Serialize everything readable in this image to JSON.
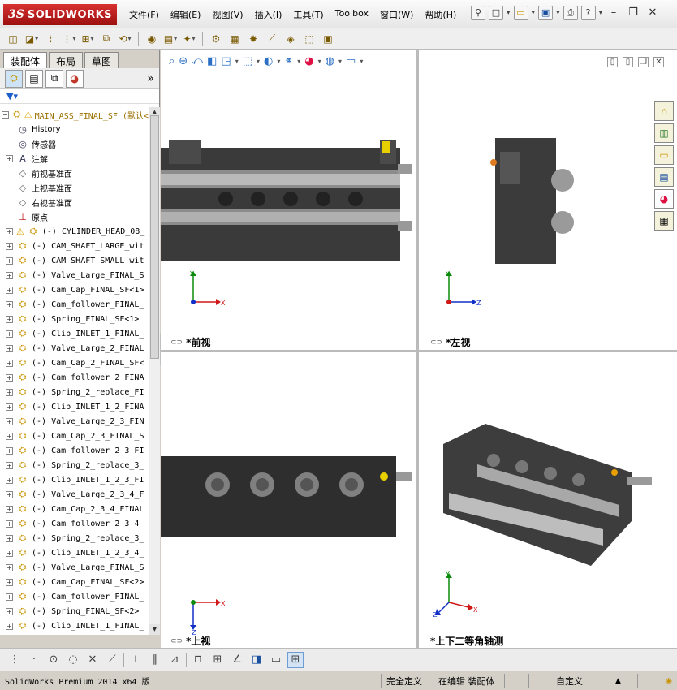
{
  "app": {
    "logo_ds": "3S",
    "logo_text": "SOLIDWORKS"
  },
  "menu": [
    "文件(F)",
    "编辑(E)",
    "视图(V)",
    "插入(I)",
    "工具(T)",
    "Toolbox",
    "窗口(W)",
    "帮助(H)"
  ],
  "feature_manager": {
    "tabs": [
      "装配体",
      "布局",
      "草图"
    ],
    "expand_arrow": "»",
    "tree": [
      {
        "label": "MAIN_ASS_FINAL_SF  (默认<",
        "icon": "assembly-icon",
        "warn": true,
        "root": true,
        "exp": "-"
      },
      {
        "label": "History",
        "icon": "history-icon",
        "exp": ""
      },
      {
        "label": "传感器",
        "icon": "sensor-icon",
        "exp": ""
      },
      {
        "label": "注解",
        "icon": "annotation-icon",
        "exp": "+"
      },
      {
        "label": "前视基准面",
        "icon": "plane-icon",
        "exp": ""
      },
      {
        "label": "上视基准面",
        "icon": "plane-icon",
        "exp": ""
      },
      {
        "label": "右视基准面",
        "icon": "plane-icon",
        "exp": ""
      },
      {
        "label": "原点",
        "icon": "origin-icon",
        "exp": ""
      },
      {
        "label": "(-) CYLINDER_HEAD_08_",
        "icon": "part-icon",
        "warn": true,
        "exp": "+"
      },
      {
        "label": "(-) CAM_SHAFT_LARGE_wit",
        "icon": "part-icon",
        "exp": "+"
      },
      {
        "label": "(-) CAM_SHAFT_SMALL_wit",
        "icon": "part-icon",
        "exp": "+"
      },
      {
        "label": "(-) Valve_Large_FINAL_S",
        "icon": "part-icon",
        "exp": "+"
      },
      {
        "label": "(-) Cam_Cap_FINAL_SF<1>",
        "icon": "part-icon",
        "exp": "+"
      },
      {
        "label": "(-) Cam_follower_FINAL_",
        "icon": "part-icon",
        "exp": "+"
      },
      {
        "label": "(-) Spring_FINAL_SF<1>",
        "icon": "part-icon",
        "exp": "+"
      },
      {
        "label": "(-) Clip_INLET_1_FINAL_",
        "icon": "part-icon",
        "exp": "+"
      },
      {
        "label": "(-) Valve_Large_2_FINAL",
        "icon": "part-icon",
        "exp": "+"
      },
      {
        "label": "(-) Cam_Cap_2_FINAL_SF<",
        "icon": "part-icon",
        "exp": "+"
      },
      {
        "label": "(-) Cam_follower_2_FINA",
        "icon": "part-icon",
        "exp": "+"
      },
      {
        "label": "(-) Spring_2_replace_FI",
        "icon": "part-icon",
        "exp": "+"
      },
      {
        "label": "(-) Clip_INLET_1_2_FINA",
        "icon": "part-icon",
        "exp": "+"
      },
      {
        "label": "(-) Valve_Large_2_3_FIN",
        "icon": "part-icon",
        "exp": "+"
      },
      {
        "label": "(-) Cam_Cap_2_3_FINAL_S",
        "icon": "part-icon",
        "exp": "+"
      },
      {
        "label": "(-) Cam_follower_2_3_FI",
        "icon": "part-icon",
        "exp": "+"
      },
      {
        "label": "(-) Spring_2_replace_3_",
        "icon": "part-icon",
        "exp": "+"
      },
      {
        "label": "(-) Clip_INLET_1_2_3_FI",
        "icon": "part-icon",
        "exp": "+"
      },
      {
        "label": "(-) Valve_Large_2_3_4_F",
        "icon": "part-icon",
        "exp": "+"
      },
      {
        "label": "(-) Cam_Cap_2_3_4_FINAL",
        "icon": "part-icon",
        "exp": "+"
      },
      {
        "label": "(-) Cam_follower_2_3_4_",
        "icon": "part-icon",
        "exp": "+"
      },
      {
        "label": "(-) Spring_2_replace_3_",
        "icon": "part-icon",
        "exp": "+"
      },
      {
        "label": "(-) Clip_INLET_1_2_3_4_",
        "icon": "part-icon",
        "exp": "+"
      },
      {
        "label": "(-) Valve_Large_FINAL_S",
        "icon": "part-icon",
        "exp": "+"
      },
      {
        "label": "(-) Cam_Cap_FINAL_SF<2>",
        "icon": "part-icon",
        "exp": "+"
      },
      {
        "label": "(-) Cam_follower_FINAL_",
        "icon": "part-icon",
        "exp": "+"
      },
      {
        "label": "(-) Spring_FINAL_SF<2>",
        "icon": "part-icon",
        "exp": "+"
      },
      {
        "label": "(-) Clip_INLET_1_FINAL_",
        "icon": "part-icon",
        "exp": "+"
      }
    ]
  },
  "views": {
    "front": "*前视",
    "left": "*左视",
    "top": "*上视",
    "iso": "*上下二等角轴测"
  },
  "triad": {
    "x": "X",
    "y": "Y",
    "z": "Z"
  },
  "status": {
    "app": "SolidWorks Premium 2014 x64 版",
    "rebuild": "完全定义",
    "edit": "在编辑 装配体",
    "custom": "自定义",
    "caret": "▲"
  },
  "colors": {
    "accent": "#c41a1a",
    "part": "#c89400",
    "axis_x": "#d01818",
    "axis_y": "#0a8a0a",
    "axis_z": "#1030c8"
  }
}
